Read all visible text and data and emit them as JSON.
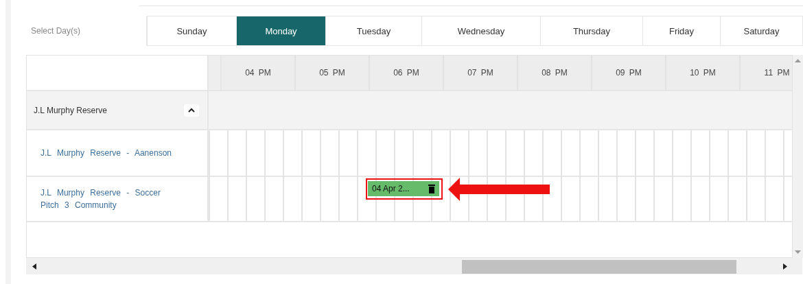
{
  "day_selector": {
    "label": "Select Day(s)",
    "days": [
      {
        "label": "Sunday",
        "selected": false
      },
      {
        "label": "Monday",
        "selected": true
      },
      {
        "label": "Tuesday",
        "selected": false
      },
      {
        "label": "Wednesday",
        "selected": false
      },
      {
        "label": "Thursday",
        "selected": false
      },
      {
        "label": "Friday",
        "selected": false
      },
      {
        "label": "Saturday",
        "selected": false
      }
    ]
  },
  "schedule": {
    "hours": [
      "04 PM",
      "05 PM",
      "06 PM",
      "07 PM",
      "08 PM",
      "09 PM",
      "10 PM",
      "11 PM"
    ],
    "group": {
      "name": "J.L Murphy Reserve",
      "expanded": true
    },
    "resources": [
      {
        "name": "J.L Murphy Reserve - Aanenson"
      },
      {
        "name": "J.L Murphy Reserve - Soccer Pitch 3 Community",
        "booking": {
          "label": "04 Apr 2..."
        }
      }
    ]
  }
}
